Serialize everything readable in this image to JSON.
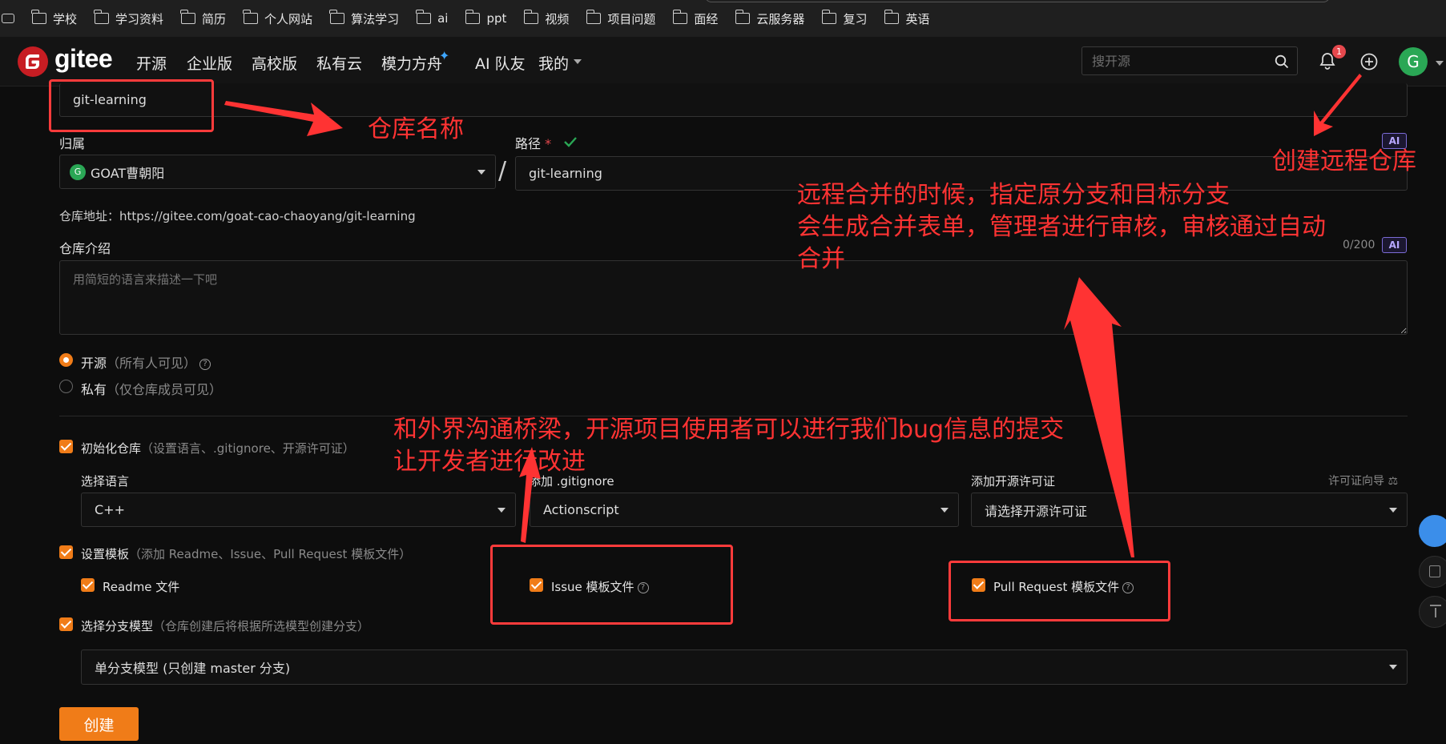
{
  "bookmarks": [
    "学校",
    "学习资料",
    "简历",
    "个人网站",
    "算法学习",
    "ai",
    "ppt",
    "视频",
    "项目问题",
    "面经",
    "云服务器",
    "复习",
    "英语"
  ],
  "nav": {
    "logo_text": "gitee",
    "items": [
      "开源",
      "企业版",
      "高校版",
      "私有云",
      "模力方舟",
      "AI 队友",
      "我的"
    ],
    "search_placeholder": "搜开源",
    "notification_count": "1",
    "avatar_letter": "G"
  },
  "form": {
    "repo_name_value": "git-learning",
    "owner_label": "归属",
    "owner_value": "GOAT曹朝阳",
    "owner_avatar": "G",
    "path_label": "路径",
    "required_mark": "*",
    "path_value": "git-learning",
    "separator": "/",
    "repo_url_label": "仓库地址：",
    "repo_url": "https://gitee.com/goat-cao-chaoyang/git-learning",
    "intro_label": "仓库介绍",
    "intro_placeholder": "用简短的语言来描述一下吧",
    "intro_count": "0/200",
    "ai_badge": "AI",
    "visibility": {
      "public_label": "开源",
      "public_hint": "（所有人可见）",
      "private_label": "私有",
      "private_hint": "（仅仓库成员可见）",
      "selected": "public"
    },
    "init_repo": {
      "label": "初始化仓库",
      "hint": "（设置语言、.gitignore、开源许可证）",
      "checked": true
    },
    "language_label": "选择语言",
    "language_value": "C++",
    "gitignore_label": "添加 .gitignore",
    "gitignore_value": "Actionscript",
    "license_label": "添加开源许可证",
    "license_guide": "许可证向导",
    "license_placeholder": "请选择开源许可证",
    "template": {
      "label": "设置模板",
      "hint": "（添加 Readme、Issue、Pull Request 模板文件）",
      "checked": true
    },
    "readme_label": "Readme 文件",
    "issue_label": "Issue 模板文件",
    "pr_label": "Pull Request 模板文件",
    "branch": {
      "label": "选择分支模型",
      "hint": "（仓库创建后将根据所选模型创建分支）",
      "checked": true
    },
    "branch_value": "单分支模型 (只创建 master 分支)",
    "create_button": "创建"
  },
  "annotations": {
    "repo_name": "仓库名称",
    "create_remote": "创建远程仓库",
    "merge_line1": "远程合并的时候，指定原分支和目标分支",
    "merge_line2": "会生成合并表单，管理者进行审核，审核通过自动",
    "merge_line3": "合并",
    "issue_line1": "和外界沟通桥梁，开源项目使用者可以进行我们bug信息的提交",
    "issue_line2": "让开发者进行改进"
  },
  "colors": {
    "accent": "#f07c18",
    "annotation": "#ff3333",
    "brand": "#c71d23"
  }
}
